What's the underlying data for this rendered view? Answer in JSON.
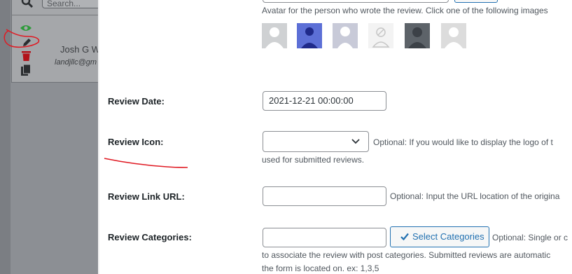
{
  "background": {
    "search_placeholder": "Search...",
    "author_name": "Josh G W",
    "author_email": "landjllc@gm"
  },
  "form": {
    "avatar_help": "Avatar for the person who wrote the review. Click one of the following images",
    "review_date": {
      "label": "Review Date:",
      "value": "2021-12-21 00:00:00"
    },
    "review_icon": {
      "label": "Review Icon:",
      "help_line1": "Optional: If you would like to display the logo of t",
      "help_line2": "used for submitted reviews."
    },
    "review_link_url": {
      "label": "Review Link URL:",
      "value": "",
      "help": "Optional: Input the URL location of the origina"
    },
    "review_categories": {
      "label": "Review Categories:",
      "value": "",
      "button_label": "Select Categories",
      "help_line1": "Optional: Single or c",
      "help_line2": "to associate the review with post categories. Submitted reviews are automatic",
      "help_line3": "the form is located on. ex: 1,3,5"
    }
  },
  "colors": {
    "accent": "#2271b1",
    "annotation": "#e01b24",
    "overlay": "#8c8f94"
  },
  "icons": [
    "search-icon",
    "eye-icon",
    "pencil-icon",
    "trash-icon",
    "copy-icon",
    "chevron-down-icon",
    "checkmark-icon"
  ]
}
